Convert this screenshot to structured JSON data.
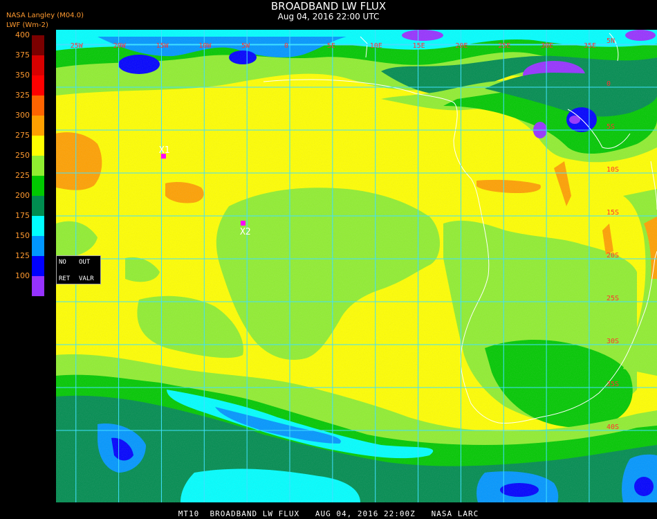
{
  "title": "BROADBAND LW FLUX",
  "subtitle": "Aug 04, 2016 22:00 UTC",
  "provider": "NASA Langley (M04.0)",
  "units": "LWF (Wm-2)",
  "legend": {
    "ticks": [
      "400",
      "375",
      "350",
      "325",
      "300",
      "275",
      "250",
      "225",
      "200",
      "175",
      "150",
      "125",
      "100"
    ],
    "bins": [
      {
        "range": "375-400",
        "color": "#7a0000"
      },
      {
        "range": "350-375",
        "color": "#d80000"
      },
      {
        "range": "325-350",
        "color": "#ff0000"
      },
      {
        "range": "300-325",
        "color": "#ff6400"
      },
      {
        "range": "275-300",
        "color": "#ffa000"
      },
      {
        "range": "250-275",
        "color": "#ffff00"
      },
      {
        "range": "225-250",
        "color": "#90ee30"
      },
      {
        "range": "200-225",
        "color": "#00c800"
      },
      {
        "range": "175-200",
        "color": "#008c50"
      },
      {
        "range": "150-175",
        "color": "#00ffff"
      },
      {
        "range": "125-150",
        "color": "#0096ff"
      },
      {
        "range": "100-125",
        "color": "#0000ff"
      },
      {
        "range": "<100",
        "color": "#9632ff"
      }
    ]
  },
  "status_box": {
    "no": "NO",
    "out": "OUT",
    "ret": "RET",
    "valr": "VALR"
  },
  "map": {
    "lon_labels": [
      "25W",
      "20W",
      "15W",
      "10W",
      "5W",
      "0",
      "5E",
      "10E",
      "15E",
      "20E",
      "25E",
      "30E",
      "35E"
    ],
    "lat_labels": [
      "5N",
      "0",
      "5S",
      "10S",
      "15S",
      "20S",
      "25S",
      "30S",
      "35S",
      "40S"
    ],
    "grid_color": "#40e0ff",
    "coast_color": "#ffffff"
  },
  "markers": [
    {
      "label": "X1",
      "lon": -14.8,
      "lat": -8.0,
      "color": "#ff00ff"
    },
    {
      "label": "X2",
      "lon": -5.5,
      "lat": -15.8,
      "color": "#ff00ff"
    }
  ],
  "footer": "MT10  BROADBAND LW FLUX   AUG 04, 2016 22:00Z   NASA LARC"
}
